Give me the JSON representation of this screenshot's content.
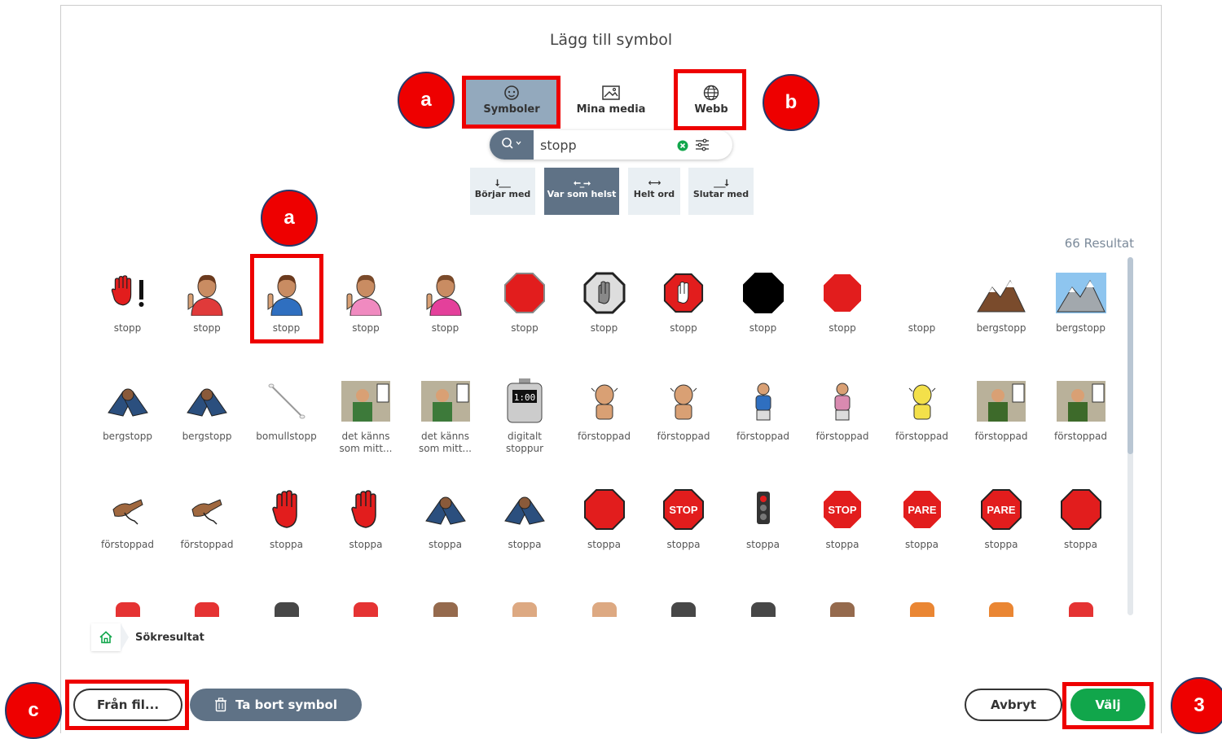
{
  "dialog": {
    "title": "Lägg till symbol"
  },
  "source_tabs": [
    {
      "label": "Symboler",
      "icon": "face-icon",
      "active": true
    },
    {
      "label": "Mina media",
      "icon": "image-icon",
      "active": false
    },
    {
      "label": "Webb",
      "icon": "globe-icon",
      "active": false
    }
  ],
  "search": {
    "value": "stopp",
    "clear_icon": "clear-icon",
    "filter_icon": "filter-icon"
  },
  "match_modes": [
    {
      "label": "Börjar med",
      "active": false
    },
    {
      "label": "Var som helst",
      "active": true
    },
    {
      "label": "Helt ord",
      "active": false
    },
    {
      "label": "Slutar med",
      "active": false
    }
  ],
  "results": {
    "count_label": "66 Resultat",
    "rows": [
      [
        "stopp",
        "stopp",
        "stopp",
        "stopp",
        "stopp",
        "stopp",
        "stopp",
        "stopp",
        "stopp",
        "stopp",
        "stopp",
        "bergstopp",
        "bergstopp"
      ],
      [
        "bergstopp",
        "bergstopp",
        "bomullstopp",
        "det känns som mitt...",
        "det känns som mitt...",
        "digitalt stoppur",
        "förstoppad",
        "förstoppad",
        "förstoppad",
        "förstoppad",
        "förstoppad",
        "förstoppad",
        "förstoppad"
      ],
      [
        "förstoppad",
        "förstoppad",
        "stoppa",
        "stoppa",
        "stoppa",
        "stoppa",
        "stoppa",
        "stoppa",
        "stoppa",
        "stoppa",
        "stoppa",
        "stoppa",
        "stoppa"
      ]
    ],
    "sign_texts": {
      "stop": "STOP",
      "pare": "PARE",
      "clock": "1:00"
    }
  },
  "breadcrumb": {
    "label": "Sökresultat"
  },
  "footer": {
    "from_file": "Från fil...",
    "delete_symbol": "Ta bort symbol",
    "cancel": "Avbryt",
    "choose": "Välj"
  },
  "annotations": {
    "a": "a",
    "b": "b",
    "c": "c",
    "three": "3"
  },
  "colors": {
    "highlight_red": "#e00000",
    "accent_slate": "#5f7286",
    "active_tab": "#93a9bd",
    "choose_green": "#11a64b"
  }
}
